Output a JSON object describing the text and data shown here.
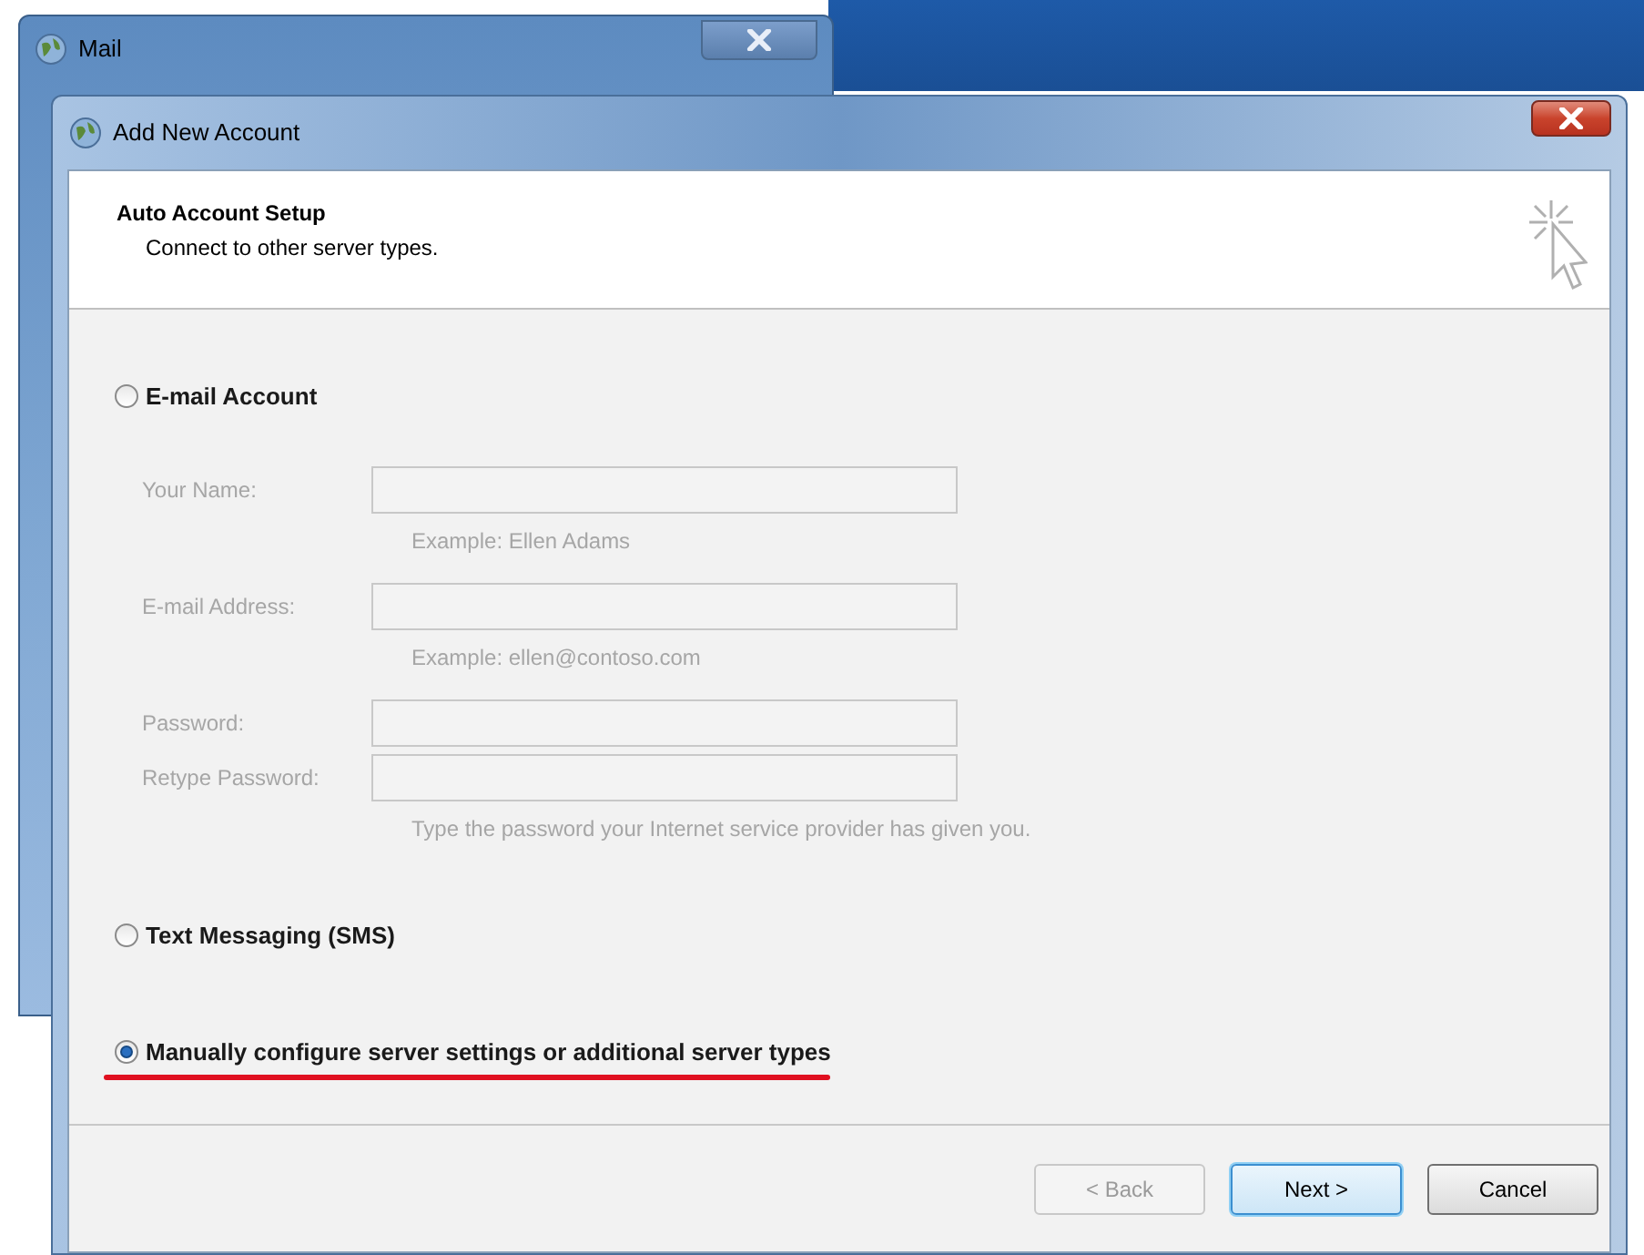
{
  "background_window": {
    "title": "Mail"
  },
  "dialog": {
    "title": "Add New Account"
  },
  "header": {
    "title": "Auto Account Setup",
    "subtitle": "Connect to other server types."
  },
  "options": [
    {
      "kind": "form",
      "label": "E-mail Account",
      "selected": false,
      "underlined": false,
      "fields": [
        {
          "label": "Your Name:",
          "hint": "Example: Ellen Adams",
          "disabled": true
        },
        {
          "label": "E-mail Address:",
          "hint": "Example: ellen@contoso.com",
          "disabled": true
        },
        {
          "label": "Password:",
          "disabled": true
        },
        {
          "label": "Retype Password:",
          "hint": "Type the password your Internet service provider has given you.",
          "disabled": true
        }
      ]
    },
    {
      "kind": "plain",
      "label": "Text Messaging (SMS)",
      "selected": false,
      "underlined": false
    },
    {
      "kind": "plain",
      "label": "Manually configure server settings or additional server types",
      "selected": true,
      "underlined": true
    }
  ],
  "buttons": [
    {
      "label": "< Back",
      "disabled": true,
      "default": false
    },
    {
      "label": "Next >",
      "disabled": false,
      "default": true
    },
    {
      "label": "Cancel",
      "disabled": false,
      "default": false
    }
  ]
}
